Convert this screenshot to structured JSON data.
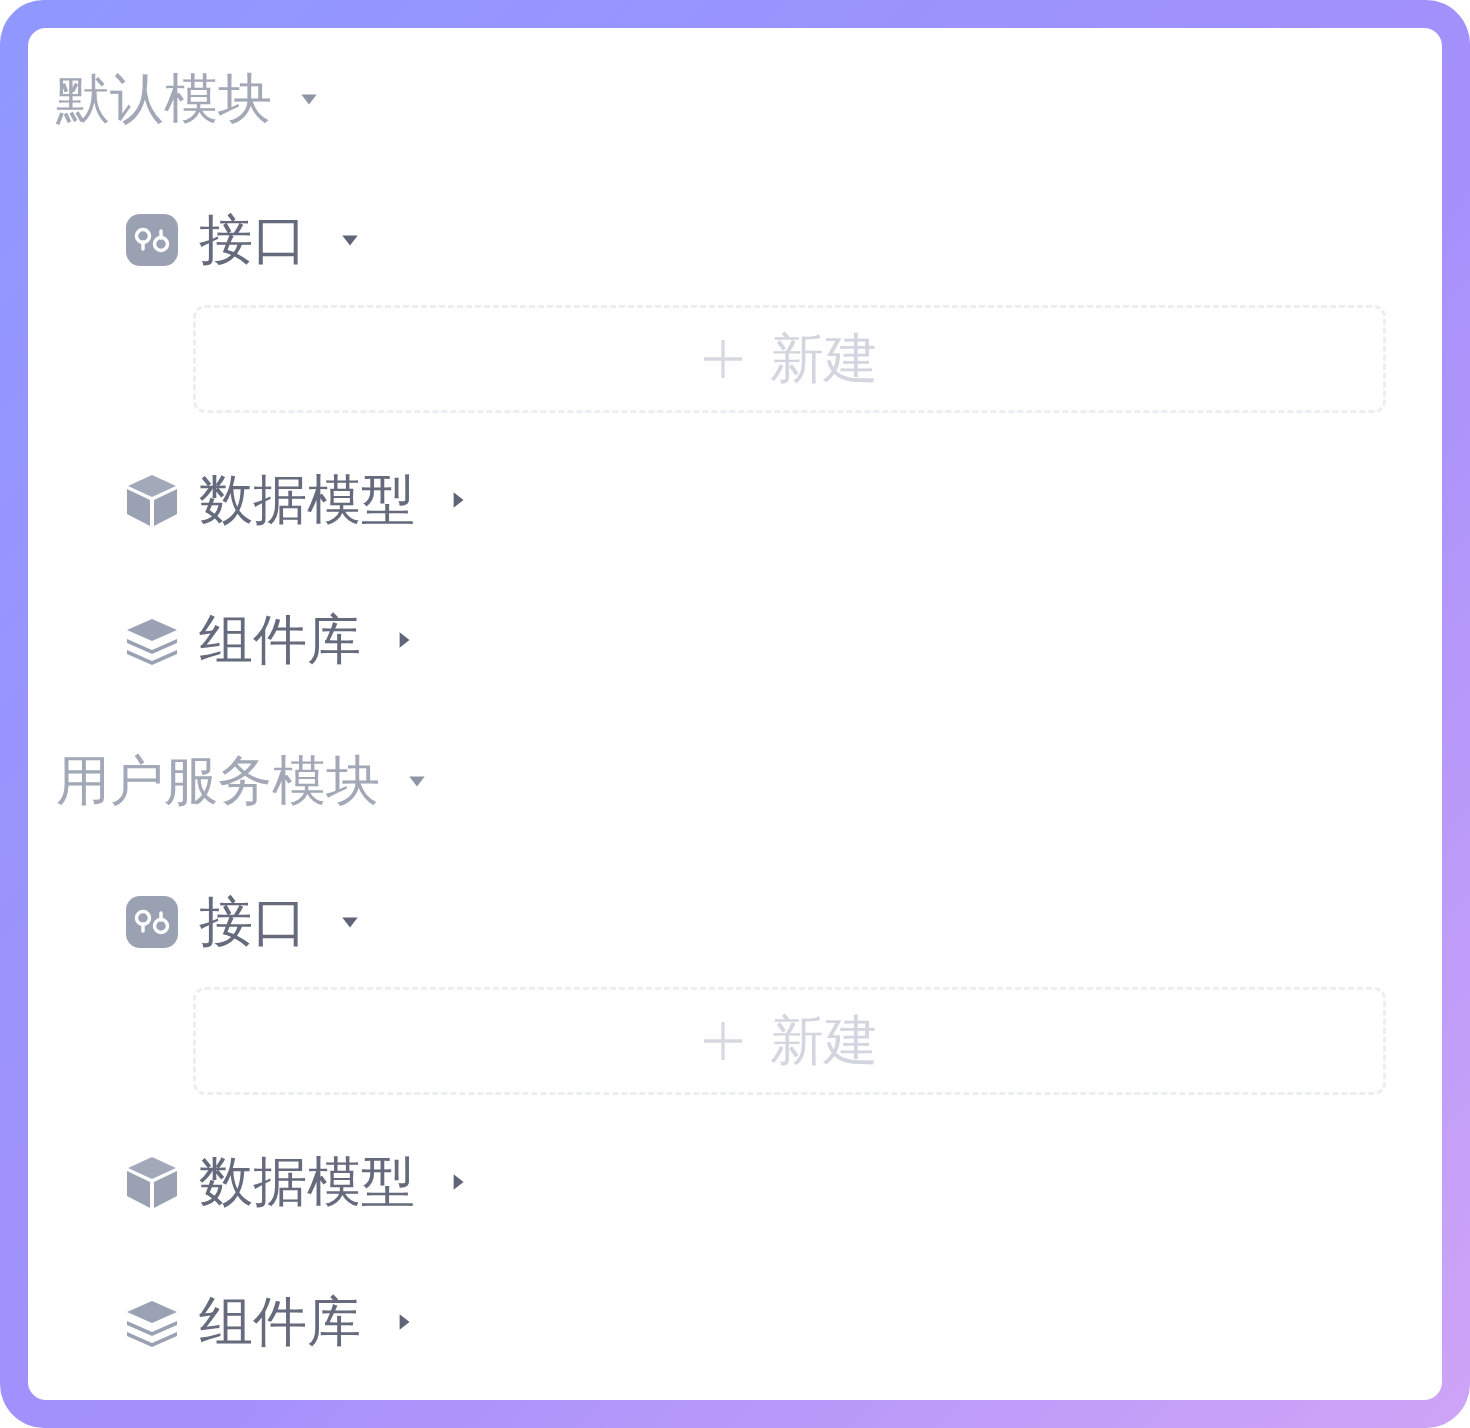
{
  "modules": [
    {
      "title": "默认模块",
      "expanded": true,
      "items": [
        {
          "kind": "api",
          "label": "接口",
          "expanded": true,
          "new_button": {
            "label": "新建"
          }
        },
        {
          "kind": "model",
          "label": "数据模型",
          "expanded": false
        },
        {
          "kind": "components",
          "label": "组件库",
          "expanded": false
        }
      ]
    },
    {
      "title": "用户服务模块",
      "expanded": true,
      "items": [
        {
          "kind": "api",
          "label": "接口",
          "expanded": true,
          "new_button": {
            "label": "新建"
          }
        },
        {
          "kind": "model",
          "label": "数据模型",
          "expanded": false
        },
        {
          "kind": "components",
          "label": "组件库",
          "expanded": false
        }
      ]
    }
  ]
}
